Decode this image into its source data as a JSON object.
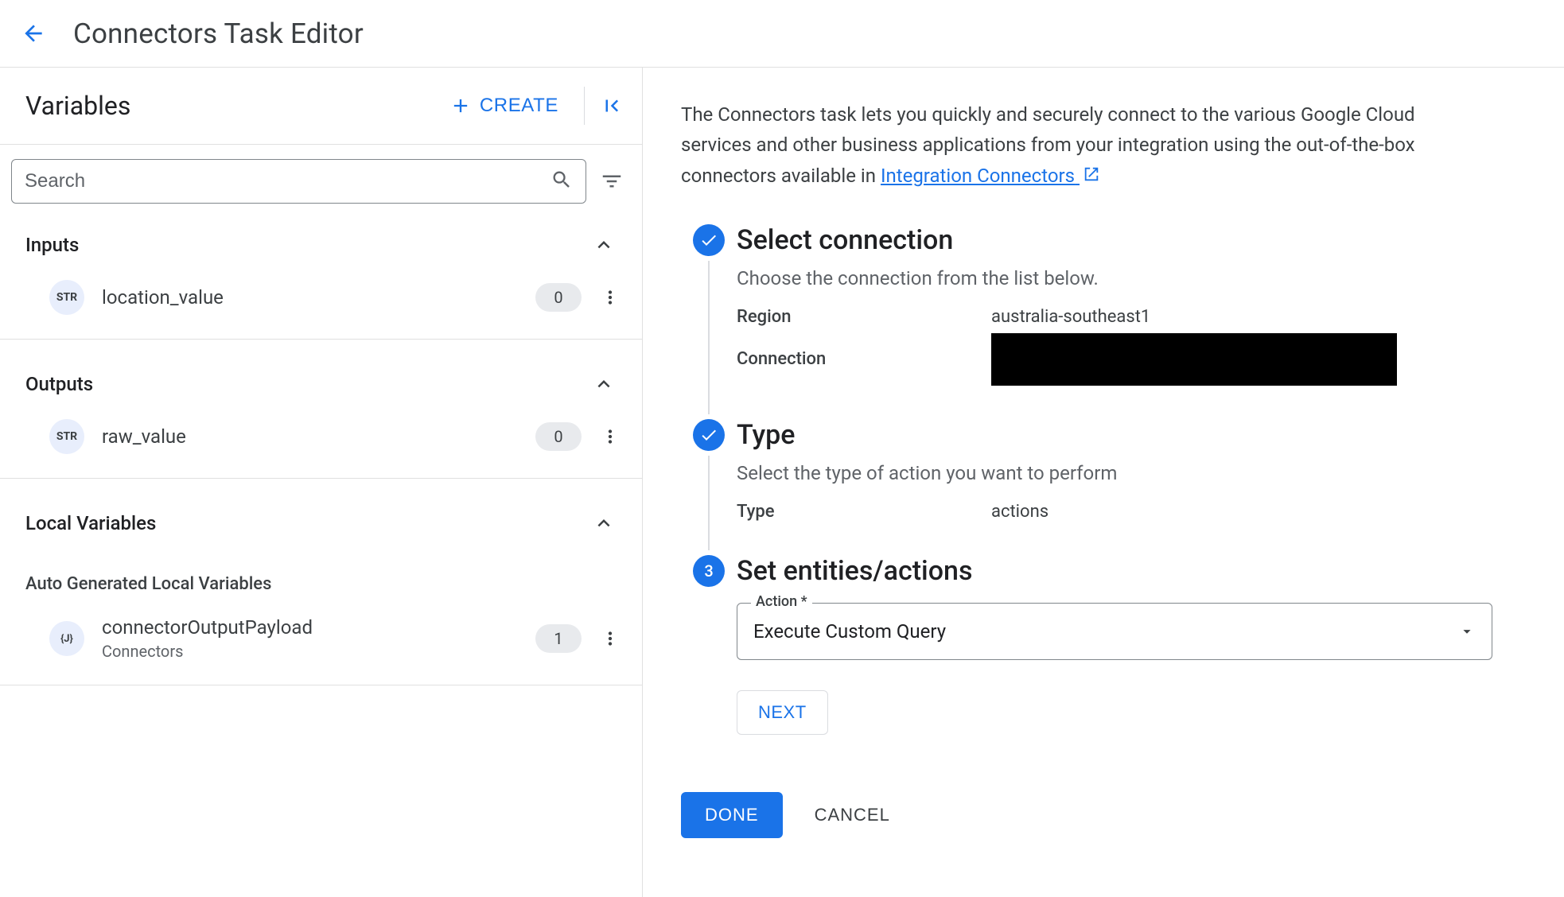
{
  "header": {
    "title": "Connectors Task Editor"
  },
  "variables_panel": {
    "title": "Variables",
    "create_label": "CREATE",
    "search_placeholder": "Search",
    "sections": {
      "inputs": {
        "title": "Inputs",
        "items": [
          {
            "type_label": "STR",
            "name": "location_value",
            "count": "0"
          }
        ]
      },
      "outputs": {
        "title": "Outputs",
        "items": [
          {
            "type_label": "STR",
            "name": "raw_value",
            "count": "0"
          }
        ]
      },
      "local": {
        "title": "Local Variables",
        "auto_gen_label": "Auto Generated Local Variables",
        "items": [
          {
            "type_label": "{J}",
            "name": "connectorOutputPayload",
            "sub": "Connectors",
            "count": "1"
          }
        ]
      }
    }
  },
  "right": {
    "description_prefix": "The Connectors task lets you quickly and securely connect to the various Google Cloud services and other business applications from your integration using the out-of-the-box connectors available in ",
    "description_link": "Integration Connectors",
    "steps": {
      "select_connection": {
        "title": "Select connection",
        "subtitle": "Choose the connection from the list below.",
        "region_label": "Region",
        "region_value": "australia-southeast1",
        "connection_label": "Connection"
      },
      "type": {
        "title": "Type",
        "subtitle": "Select the type of action you want to perform",
        "type_label": "Type",
        "type_value": "actions"
      },
      "set_entities": {
        "number": "3",
        "title": "Set entities/actions",
        "action_field_label": "Action *",
        "action_value": "Execute Custom Query",
        "next_label": "NEXT"
      }
    },
    "done_label": "DONE",
    "cancel_label": "CANCEL"
  }
}
